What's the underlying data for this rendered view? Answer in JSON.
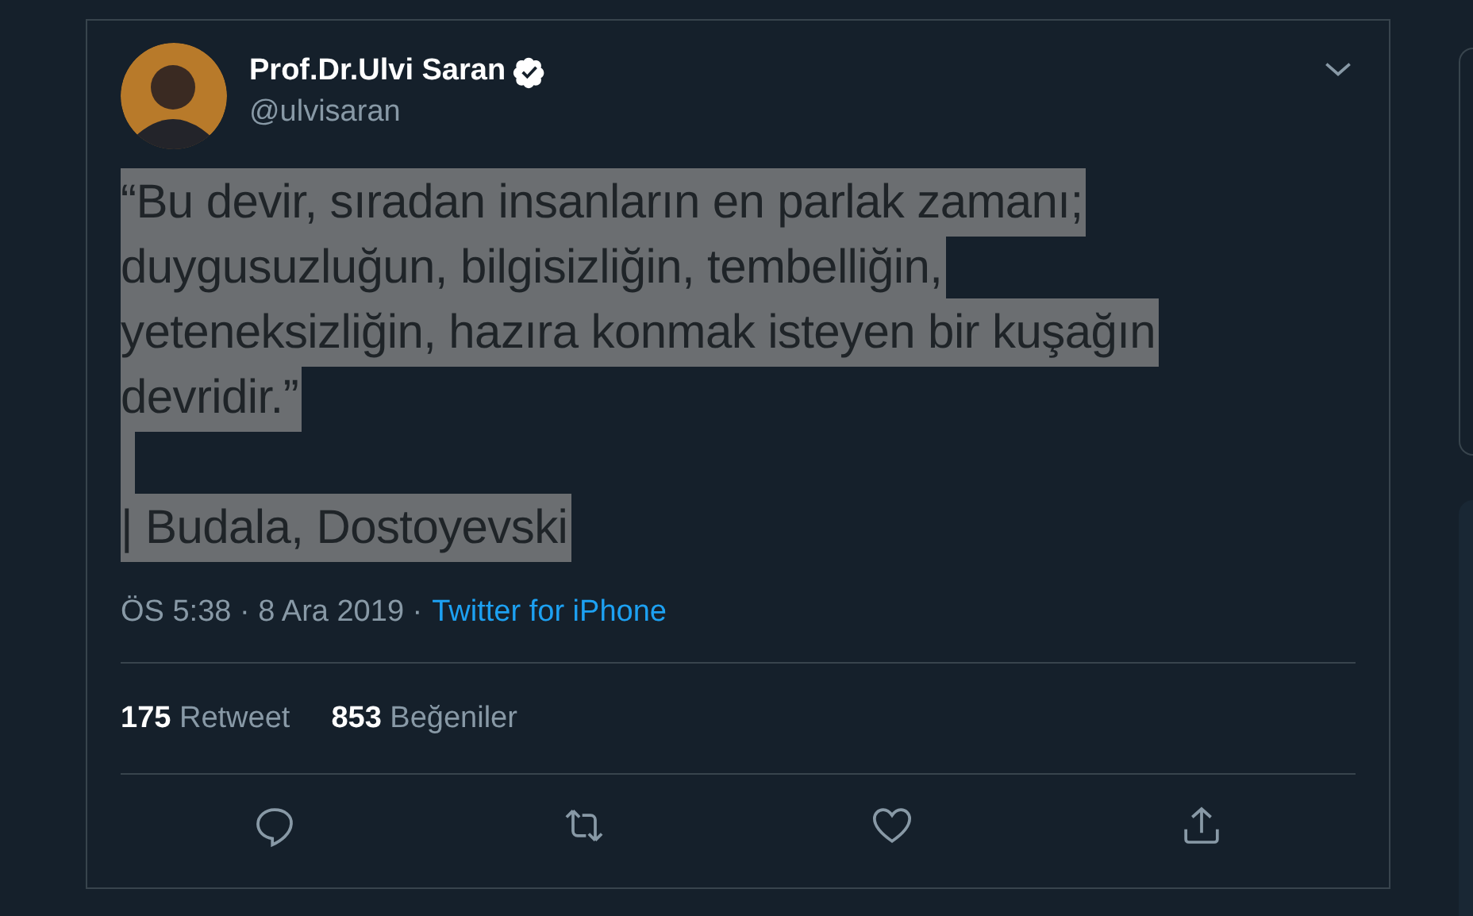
{
  "tweet": {
    "author": {
      "name": "Prof.Dr.Ulvi Saran",
      "verified": true,
      "handle": "@ulvisaran"
    },
    "highlighted": true,
    "quote_lines": [
      "“Bu devir, sıradan insanların en parlak zamanı;",
      "duygusuzluğun, bilgisizliğin, tembelliğin,",
      "yeteneksizliğin, hazıra konmak isteyen bir kuşağın",
      "devridir.”"
    ],
    "attribution": "| Budala, Dostoyevski",
    "time": "ÖS 5:38 · 8 Ara 2019 ·",
    "source": "Twitter for iPhone",
    "stats": [
      {
        "count": "175",
        "label": "Retweet"
      },
      {
        "count": "853",
        "label": "Beğeniler"
      }
    ],
    "actions": [
      {
        "kind": "reply"
      },
      {
        "kind": "retweet"
      },
      {
        "kind": "like"
      },
      {
        "kind": "share"
      }
    ]
  }
}
